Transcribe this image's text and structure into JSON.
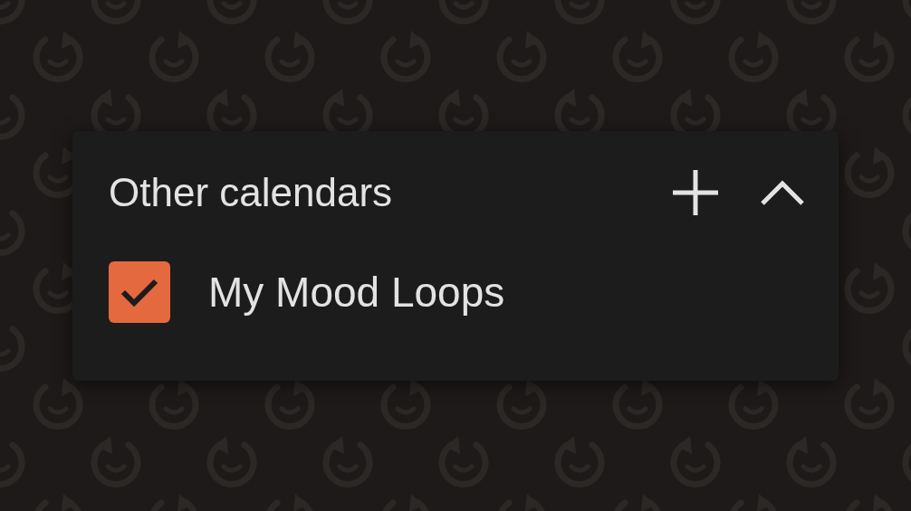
{
  "panel": {
    "title": "Other calendars",
    "expanded": true
  },
  "calendars": [
    {
      "name": "My Mood Loops",
      "checked": true,
      "color": "#e5693f"
    }
  ]
}
